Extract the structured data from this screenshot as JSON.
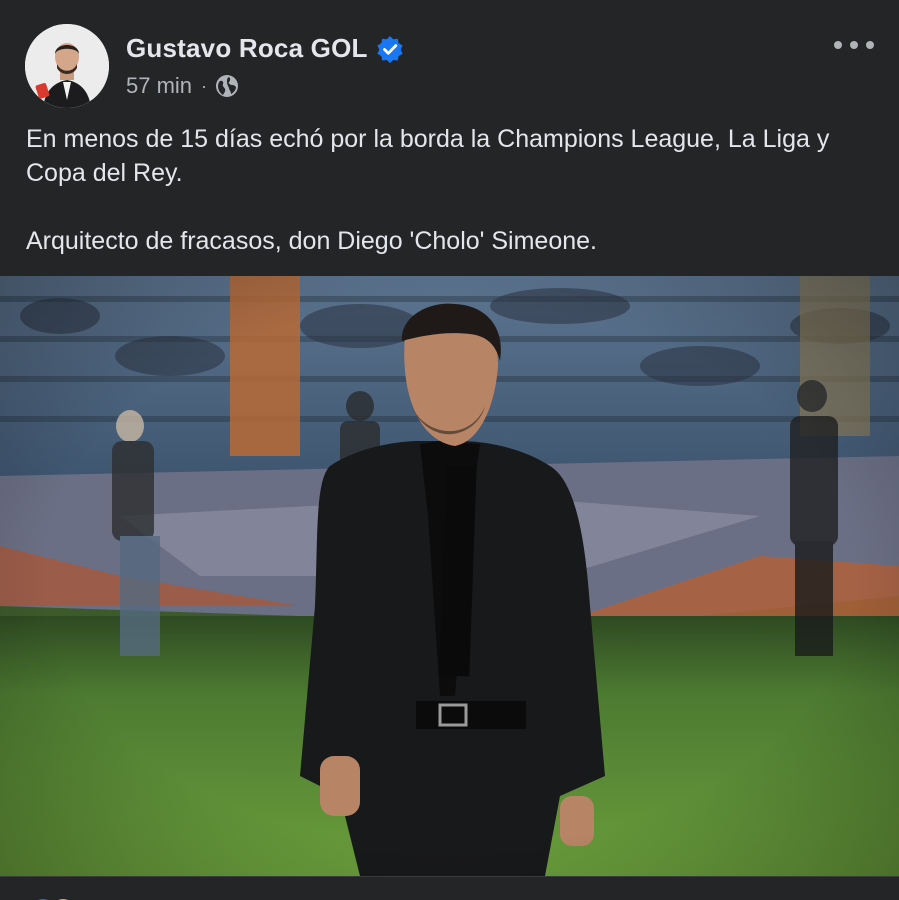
{
  "post": {
    "author": "Gustavo Roca GOL",
    "verified": true,
    "time": "57 min",
    "separator": "·",
    "audience_icon": "globe-icon",
    "more_icon": "more-options-icon",
    "paragraphs": [
      "En menos de 15 días echó por la borda la Champions League, La Liga y Copa del Rey.",
      "Arquitecto de fracasos, don Diego 'Cholo' Simeone."
    ]
  },
  "reactions": [
    "like-reaction-icon",
    "haha-reaction-icon"
  ],
  "colors": {
    "background": "#242526",
    "text_primary": "#e4e6eb",
    "text_secondary": "#b0b3b8",
    "verified_badge": "#1877f2"
  }
}
